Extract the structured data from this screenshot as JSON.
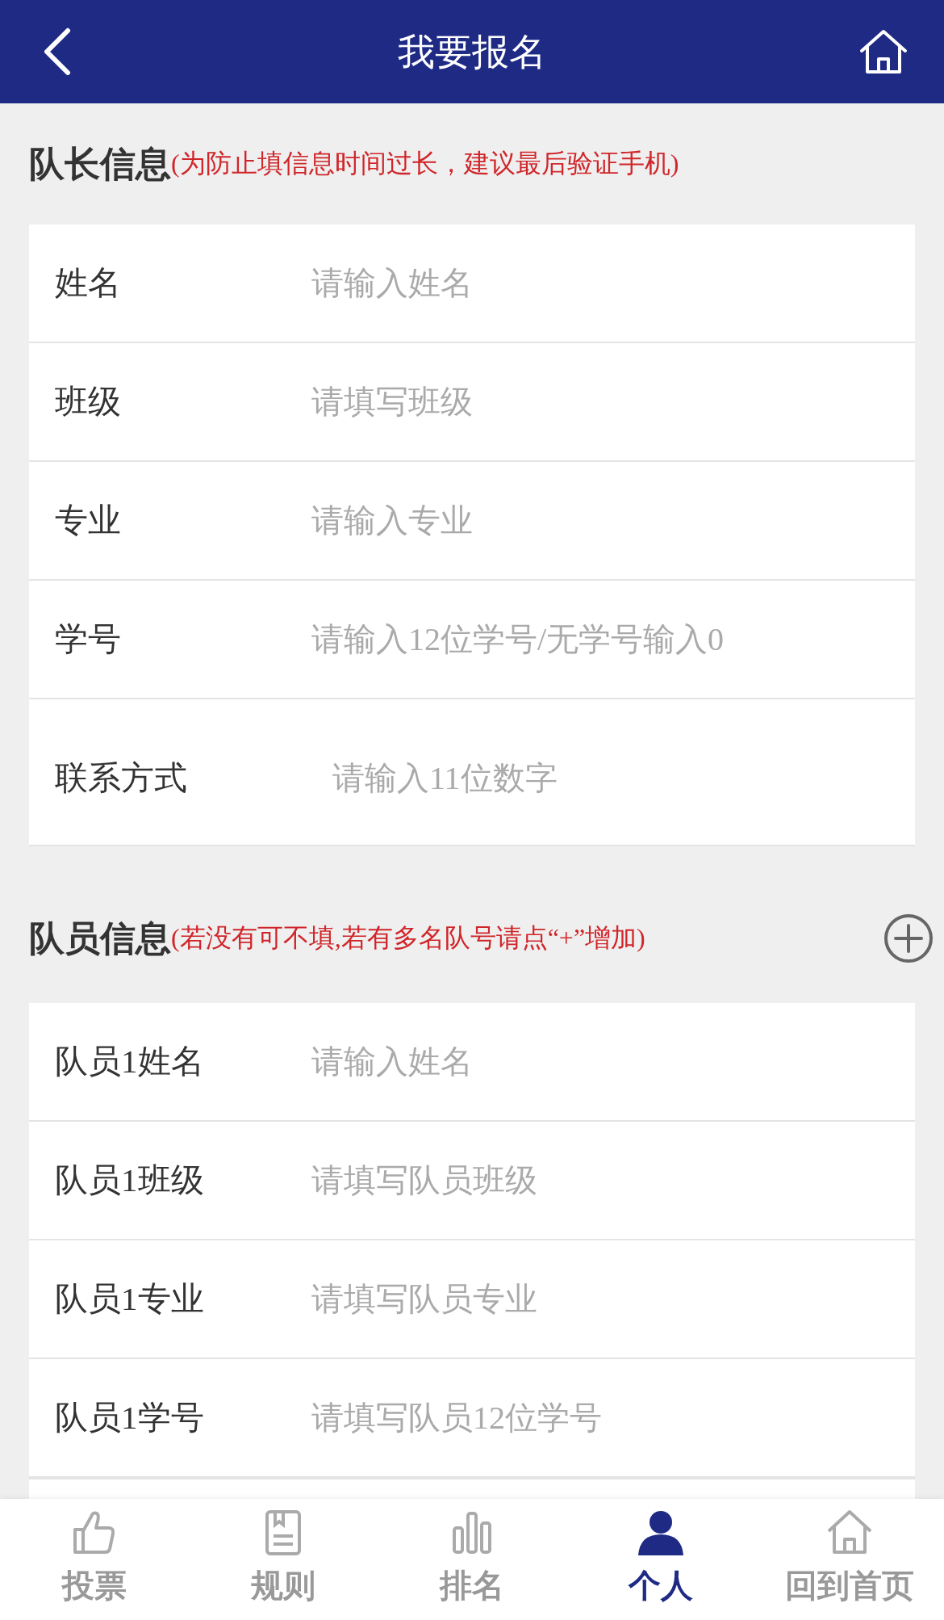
{
  "header": {
    "title": "我要报名"
  },
  "sections": [
    {
      "title": "队长信息",
      "note": "(为防止填信息时间过长，建议最后验证手机)",
      "add_button": false,
      "fields": [
        {
          "label": "姓名",
          "placeholder": "请输入姓名"
        },
        {
          "label": "班级",
          "placeholder": "请填写班级"
        },
        {
          "label": "专业",
          "placeholder": "请输入专业"
        },
        {
          "label": "学号",
          "placeholder": "请输入12位学号/无学号输入0"
        },
        {
          "label": "联系方式",
          "placeholder": "请输入11位数字",
          "kind": "tall"
        }
      ]
    },
    {
      "title": "队员信息",
      "note": "(若没有可不填,若有多名队号请点“+”增加)",
      "add_button": true,
      "fields": [
        {
          "label": "队员1姓名",
          "placeholder": "请输入姓名"
        },
        {
          "label": "队员1班级",
          "placeholder": "请填写队员班级"
        },
        {
          "label": "队员1专业",
          "placeholder": "请填写队员专业"
        },
        {
          "label": "队员1学号",
          "placeholder": "请填写队员12位学号"
        }
      ]
    }
  ],
  "tab_bar": [
    {
      "label": "投票",
      "selected": false
    },
    {
      "label": "规则",
      "selected": false
    },
    {
      "label": "排名",
      "selected": false
    },
    {
      "label": "个人",
      "selected": true
    },
    {
      "label": "回到首页",
      "selected": false
    }
  ]
}
